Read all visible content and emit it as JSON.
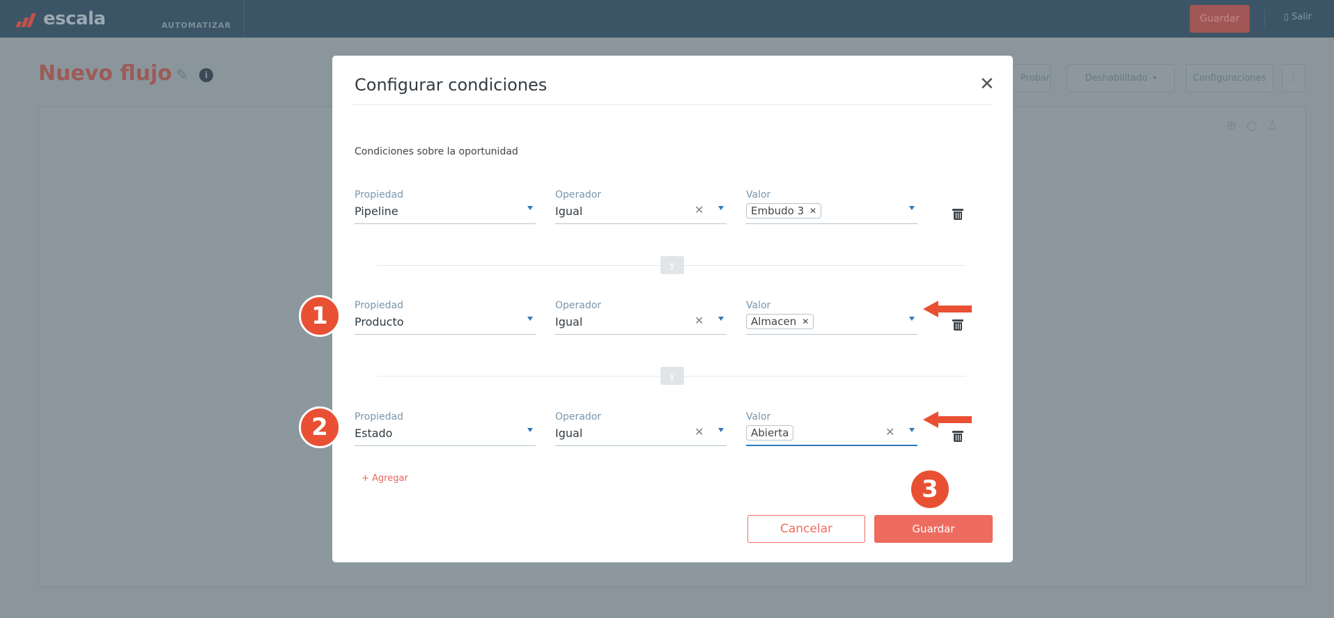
{
  "topbar": {
    "brand": "escala",
    "nav_label": "AUTOMATIZAR",
    "save_label": "Guardar",
    "exit_label": "Salir"
  },
  "page": {
    "title": "Nuevo flujo",
    "info_glyph": "i",
    "buttons": {
      "test": "Probar",
      "status": "Deshabilitado",
      "settings": "Configuraciones"
    }
  },
  "modal": {
    "title": "Configurar condiciones",
    "section_label": "Condiciones sobre la oportunidad",
    "and_label": "y",
    "add_label": "+ Agregar",
    "cancel_label": "Cancelar",
    "save_label": "Guardar",
    "conditions": [
      {
        "property_label": "Propiedad",
        "property": "Pipeline",
        "operator_label": "Operador",
        "operator": "Igual",
        "value_label": "Valor",
        "value": "Embudo 3"
      },
      {
        "property_label": "Propiedad",
        "property": "Producto",
        "operator_label": "Operador",
        "operator": "Igual",
        "value_label": "Valor",
        "value": "Almacen"
      },
      {
        "property_label": "Propiedad",
        "property": "Estado",
        "operator_label": "Operador",
        "operator": "Igual",
        "value_label": "Valor",
        "value": "Abierta"
      }
    ]
  },
  "annotations": {
    "step1": "1",
    "step2": "2",
    "step3": "3"
  },
  "colors": {
    "accent": "#ee6b5f",
    "topbar": "#3c5566",
    "focus": "#2f79b9",
    "annotation": "#e95033"
  },
  "icons": [
    "close-icon",
    "chevron-down-icon",
    "clear-icon",
    "trash-icon",
    "pencil-icon",
    "info-icon",
    "exit-icon",
    "arrow-left-icon"
  ]
}
